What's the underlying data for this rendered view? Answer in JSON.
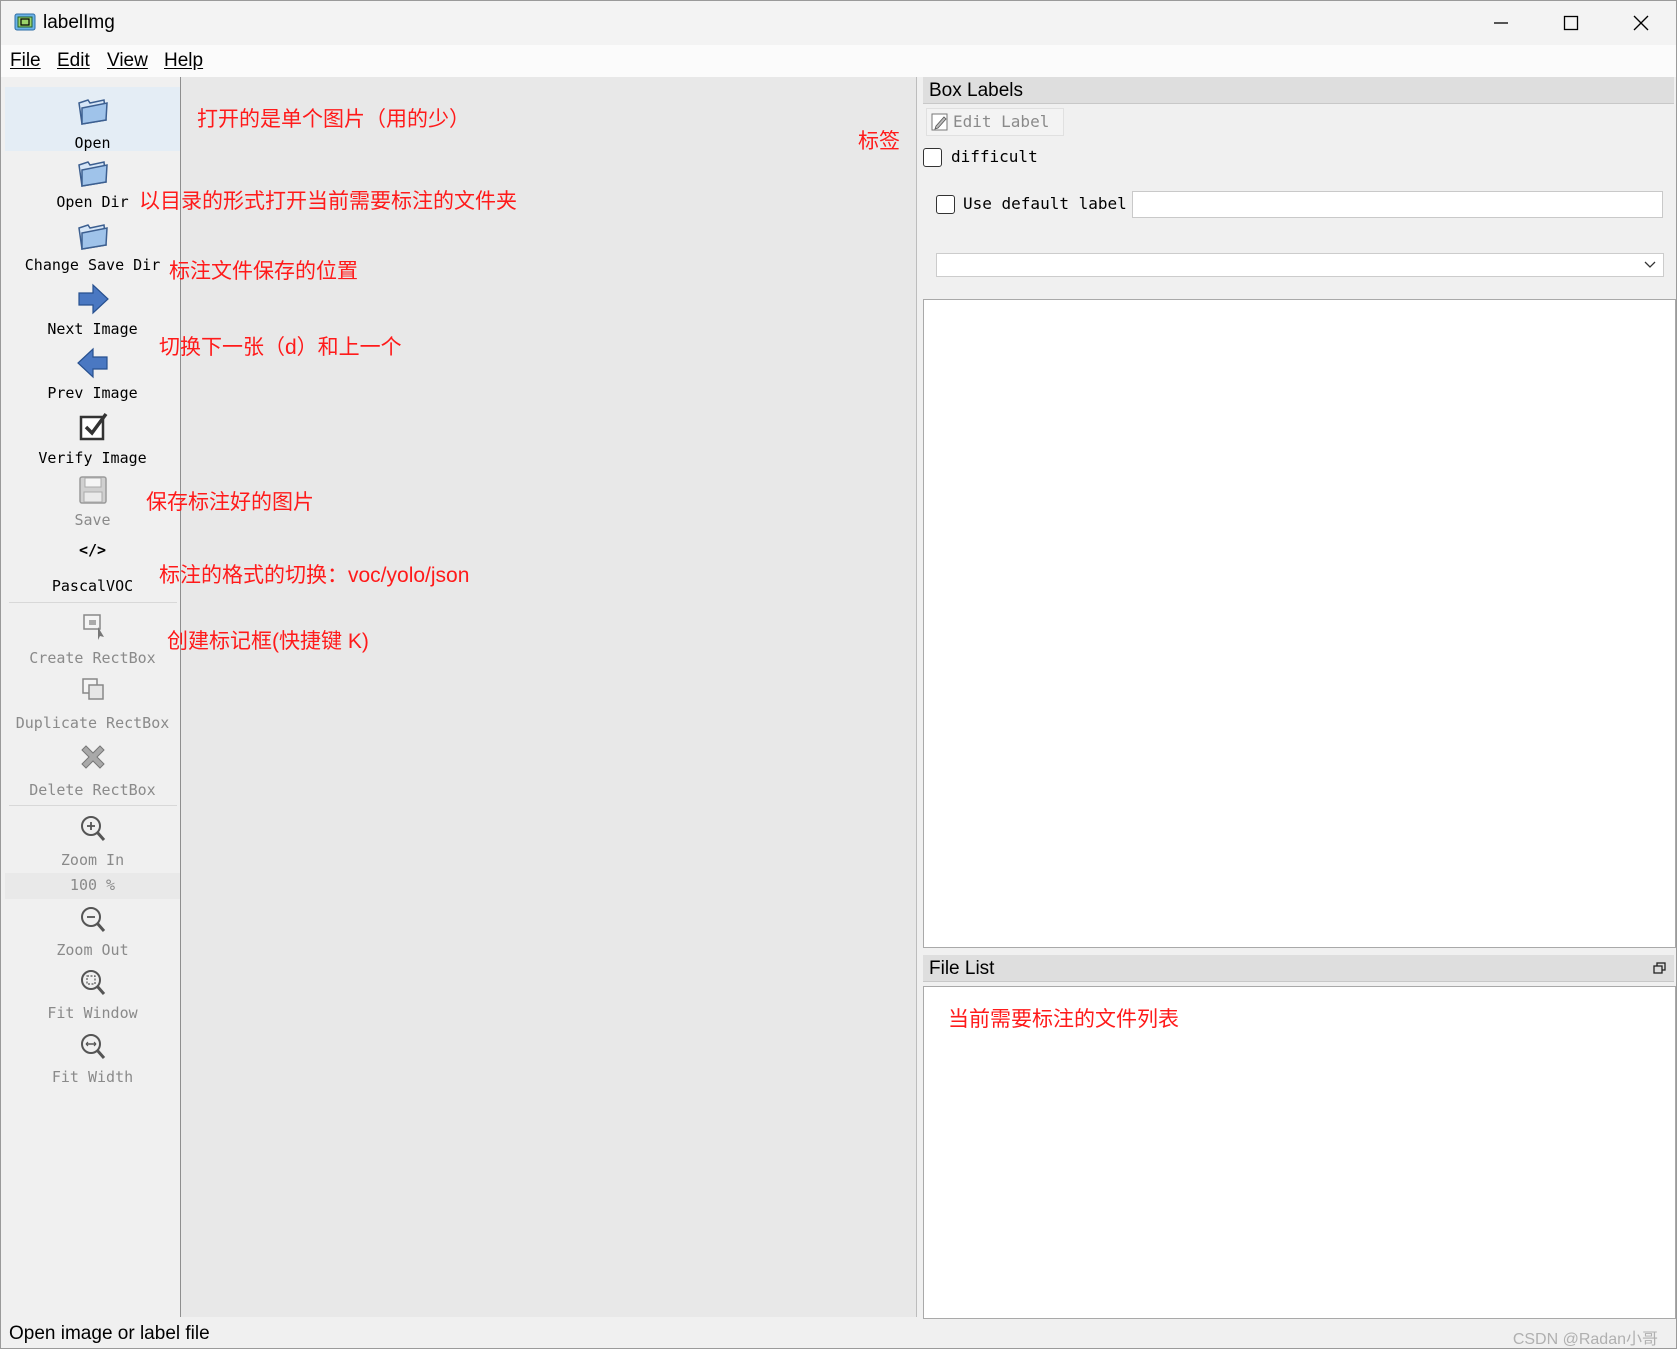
{
  "window": {
    "title": "labelImg",
    "controls": [
      "minimize",
      "maximize",
      "close"
    ]
  },
  "menu": [
    "File",
    "Edit",
    "View",
    "Help"
  ],
  "toolbar": {
    "open": "Open",
    "open_dir": "Open Dir",
    "change_save_dir": "Change Save Dir",
    "next_image": "Next Image",
    "prev_image": "Prev Image",
    "verify_image": "Verify Image",
    "save": "Save",
    "format": "PascalVOC",
    "format_icon_text": "</>",
    "create_rectbox": "Create RectBox",
    "duplicate_rectbox": "Duplicate RectBox",
    "delete_rectbox": "Delete RectBox",
    "zoom_in": "Zoom In",
    "zoom_value": "100 %",
    "zoom_out": "Zoom Out",
    "fit_window": "Fit Window",
    "fit_width": "Fit Width"
  },
  "annotations": {
    "open": "打开的是单个图片（用的少）",
    "open_dir": "以目录的形式打开当前需要标注的文件夹",
    "change_save_dir": "标注文件保存的位置",
    "next_prev": "切换下一张（d）和上一个",
    "save": "保存标注好的图片",
    "format": "标注的格式的切换：voc/yolo/json",
    "create": "创建标记框(快捷键 K)",
    "labels": "标签",
    "file_list": "当前需要标注的文件列表"
  },
  "box_labels": {
    "title": "Box Labels",
    "edit_label": "Edit Label",
    "difficult": "difficult",
    "use_default_label": "Use default label",
    "default_label_value": "",
    "combo_value": ""
  },
  "file_list": {
    "title": "File List"
  },
  "status": {
    "text": "Open image or label file",
    "watermark": "CSDN @Radan小哥"
  },
  "colors": {
    "annotation": "#ff1a1a",
    "icon_blue": "#4a78c2"
  }
}
